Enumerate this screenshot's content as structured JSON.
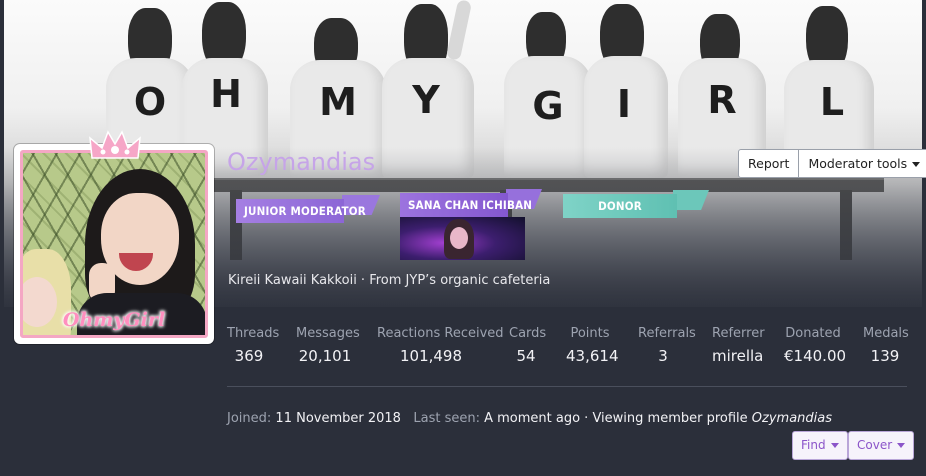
{
  "cover": {
    "letters": [
      "O",
      "H",
      "M",
      "Y",
      "G",
      "I",
      "R",
      "L"
    ]
  },
  "profile": {
    "username": "Ozymandias",
    "avatar_logo": "OhmyGirl",
    "tagline": "Kireii Kawaii Kakkoii · From JYP’s organic cafeteria"
  },
  "banners": [
    {
      "label": "JUNIOR MODERATOR",
      "color": "#9b76dd"
    },
    {
      "label": "SANA CHAN ICHIBAN",
      "color": "#8f63d4"
    },
    {
      "label": "DONOR",
      "color": "#6cc7ba"
    }
  ],
  "actions": {
    "report": "Report",
    "moderator_tools": "Moderator tools",
    "find": "Find",
    "cover": "Cover"
  },
  "stats": [
    {
      "label": "Threads",
      "value": "369"
    },
    {
      "label": "Messages",
      "value": "20,101"
    },
    {
      "label": "Reactions Received",
      "value": "101,498"
    },
    {
      "label": "Cards",
      "value": "54"
    },
    {
      "label": "Points",
      "value": "43,614"
    },
    {
      "label": "Referrals",
      "value": "3"
    },
    {
      "label": "Referrer",
      "value": "mirella"
    },
    {
      "label": "Donated",
      "value": "€140.00"
    },
    {
      "label": "Medals",
      "value": "139"
    }
  ],
  "meta": {
    "joined_label": "Joined:",
    "joined_value": "11 November 2018",
    "last_seen_label": "Last seen:",
    "last_seen_value": "A moment ago · Viewing member profile",
    "last_seen_target": "Ozymandias"
  },
  "colors": {
    "background": "#2b2f3a",
    "username": "#c6a4e8",
    "accent": "#8b55c9"
  }
}
